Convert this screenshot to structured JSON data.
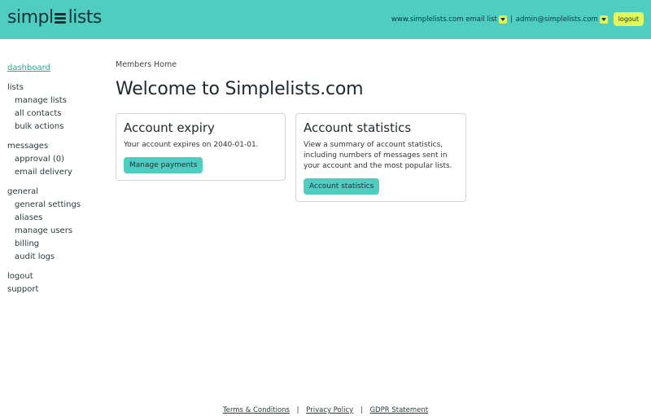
{
  "header": {
    "logo_left": "simpl",
    "logo_right": "lists",
    "email_list": "www.simplelists.com email list",
    "separator": "|",
    "account": "admin@simplelists.com",
    "logout_label": "logout",
    "background": "#4ecdc0",
    "accent": "#e4f75a"
  },
  "sidebar": {
    "dashboard": "dashboard",
    "lists": "lists",
    "manage_lists": "manage lists",
    "all_contacts": "all contacts",
    "bulk_actions": "bulk actions",
    "messages": "messages",
    "approval": "approval (0)",
    "email_delivery": "email delivery",
    "general": "general",
    "general_settings": "general settings",
    "aliases": "aliases",
    "manage_users": "manage users",
    "billing": "billing",
    "audit_logs": "audit logs",
    "logout": "logout",
    "support": "support"
  },
  "main": {
    "breadcrumb": "Members Home",
    "title": "Welcome to Simplelists.com",
    "cards": [
      {
        "title": "Account expiry",
        "text": "Your account expires on 2040-01-01.",
        "button": "Manage payments"
      },
      {
        "title": "Account statistics",
        "text": "View a summary of account statistics, including numbers of messages sent in your account and the most popular lists.",
        "button": "Account statistics"
      }
    ]
  },
  "footer": {
    "terms": "Terms & Conditions",
    "privacy": "Privacy Policy",
    "gdpr": "GDPR Statement",
    "separator": "|"
  }
}
